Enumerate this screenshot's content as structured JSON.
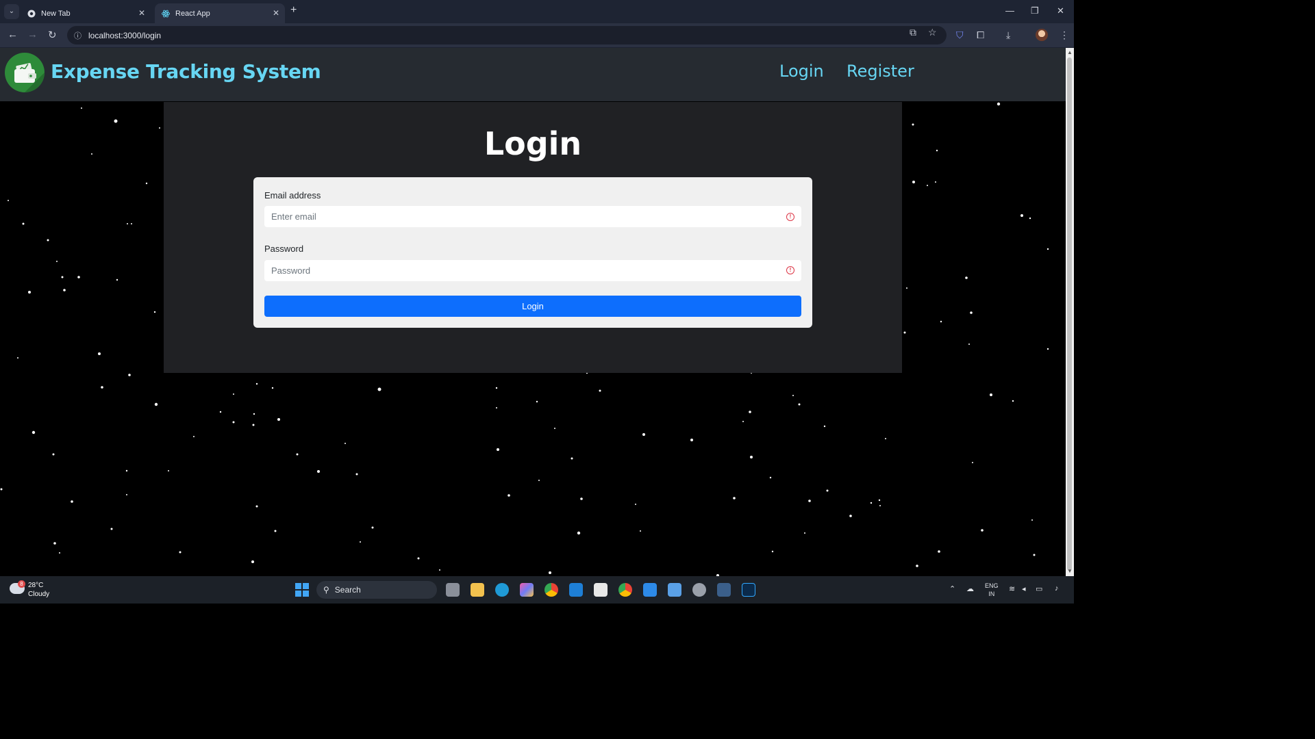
{
  "browser": {
    "tabs": [
      {
        "title": "New Tab",
        "active": false
      },
      {
        "title": "React App",
        "active": true
      }
    ],
    "url": "localhost:3000/login"
  },
  "navbar": {
    "brand": "Expense Tracking System",
    "links": [
      "Login",
      "Register"
    ]
  },
  "login": {
    "heading": "Login",
    "email_label": "Email address",
    "email_placeholder": "Enter email",
    "password_label": "Password",
    "password_placeholder": "Password",
    "submit_label": "Login"
  },
  "taskbar": {
    "weather_temp": "28°C",
    "weather_condition": "Cloudy",
    "weather_badge": "8",
    "search_label": "Search",
    "language_line1": "ENG",
    "language_line2": "IN"
  },
  "colors": {
    "brand": "#67d6f3",
    "primary_button": "#0d6efd",
    "error_icon": "#dc3545",
    "navbar_bg": "#262b31",
    "container_bg": "#202124"
  }
}
